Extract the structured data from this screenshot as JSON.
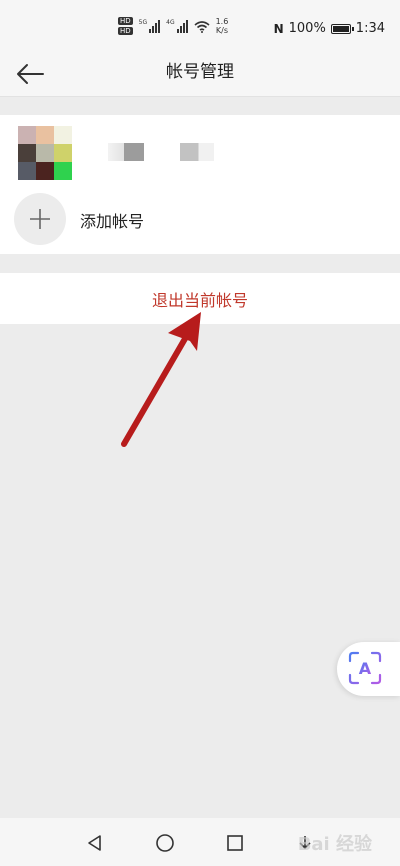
{
  "status_bar": {
    "hd1": "HD",
    "hd2": "HD",
    "net1": "5G",
    "net2": "4G",
    "speed_value": "1.6",
    "speed_unit": "K/s",
    "nfc": "N",
    "battery_percent": "100%",
    "time": "1:34"
  },
  "header": {
    "title": "帐号管理",
    "back_icon": "back-arrow-icon"
  },
  "accounts": {
    "add_label": "添加帐号",
    "add_icon": "plus-icon",
    "avatar_colors": [
      "#cbb2b2",
      "#e9c1a0",
      "#f2f2e2",
      "#4a3f3a",
      "#b9b9a9",
      "#cfd26a",
      "#575b66",
      "#4b231f",
      "#2fd24e"
    ]
  },
  "actions": {
    "logout_label": "退出当前帐号"
  },
  "annotation": {
    "arrow_color": "#b71c1c"
  },
  "floating": {
    "icon": "ai-assistant-icon",
    "glyph": "A"
  },
  "nav": {
    "back_icon": "triangle-back-icon",
    "home_icon": "circle-home-icon",
    "recents_icon": "square-recents-icon",
    "extra_icon": "download-icon"
  },
  "watermark": {
    "text": "Bai 经验"
  }
}
